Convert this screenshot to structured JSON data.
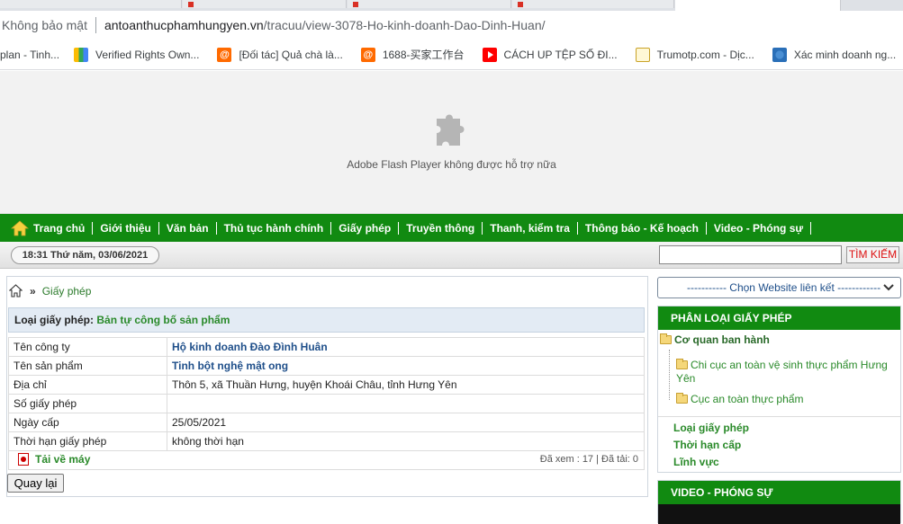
{
  "browser": {
    "security_label": "Không bảo mật",
    "url_host": "antoanthucphamhungyen.vn",
    "url_path": "/tracuu/view-3078-Ho-kinh-doanh-Dao-Dinh-Huan/",
    "bookmarks": [
      {
        "label": "plan - Tinh...",
        "icon": "none"
      },
      {
        "label": "Verified Rights Own...",
        "icon": "shield-icon"
      },
      {
        "label": "[Đối tác] Quả chà là...",
        "icon": "alibaba-icon"
      },
      {
        "label": "1688-买家工作台",
        "icon": "alibaba-icon"
      },
      {
        "label": "CÁCH UP TỆP SỐ ĐI...",
        "icon": "youtube-icon"
      },
      {
        "label": "Trumotp.com - Dịc...",
        "icon": "document-icon"
      },
      {
        "label": "Xác minh doanh ng...",
        "icon": "globe-icon"
      }
    ]
  },
  "flash": {
    "message": "Adobe Flash Player không được hỗ trợ nữa",
    "icon": "puzzle-plugin-icon"
  },
  "nav": {
    "items": [
      "Trang chủ",
      "Giới thiệu",
      "Văn bản",
      "Thủ tục hành chính",
      "Giấy phép",
      "Truyền thông",
      "Thanh, kiểm tra",
      "Thông báo - Kế hoạch",
      "Video - Phóng sự"
    ]
  },
  "strip": {
    "datetime": "18:31 Thứ năm, 03/06/2021",
    "search_value": "",
    "search_button": "TÌM KIẾM"
  },
  "content": {
    "breadcrumb_sep": "»",
    "breadcrumb_current": "Giấy phép",
    "license_type_label": "Loại giấy phép:",
    "license_type_value": "Bản tự công bố sản phẩm",
    "rows": [
      {
        "label": "Tên công ty",
        "value": "Hộ kinh doanh Đào Đình Huân"
      },
      {
        "label": "Tên sản phẩm",
        "value": "Tinh bột nghệ mật ong"
      },
      {
        "label": "Địa chỉ",
        "value": "Thôn 5, xã Thuần Hưng, huyện Khoái Châu, tỉnh Hưng Yên"
      },
      {
        "label": "Số giấy phép",
        "value": ""
      },
      {
        "label": "Ngày cấp",
        "value": "25/05/2021"
      },
      {
        "label": "Thời hạn giấy phép",
        "value": "không thời hạn"
      }
    ],
    "download_label": "Tải về máy",
    "stats": "Đã xem : 17 | Đã tải: 0",
    "back_button": "Quay lại"
  },
  "sidebar": {
    "website_select": "----------- Chọn Website liên kết ------------",
    "license_heading": "PHÂN LOẠI GIẤY PHÉP",
    "tree_root": "Cơ quan ban hành",
    "tree_children": [
      "Chi cục an toàn vệ sinh thực phẩm Hưng Yên",
      "Cục an toàn thực phẩm"
    ],
    "links": [
      "Loại giấy phép",
      "Thời hạn cấp",
      "Lĩnh vực"
    ],
    "video_heading": "VIDEO - PHÓNG SỰ"
  },
  "colors": {
    "nav_green": "#118a11",
    "link_green": "#2a8a2a",
    "value_blue": "#1f4f8a",
    "search_red": "#d11111"
  }
}
